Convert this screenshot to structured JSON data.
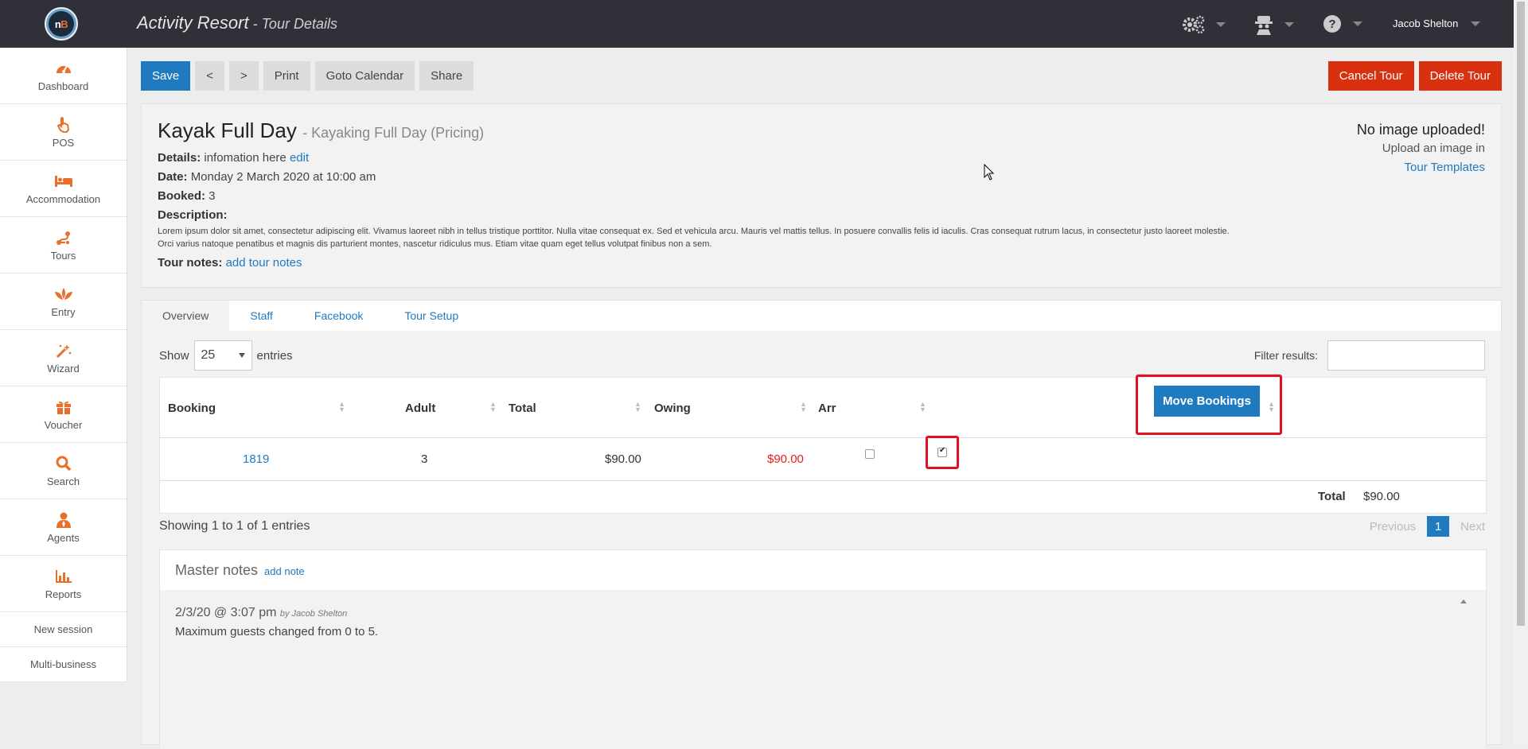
{
  "topbar": {
    "logo_n": "n",
    "logo_b": "B",
    "app_name": "Activity Resort",
    "separator": " - ",
    "page_name": "Tour Details",
    "user_name": "Jacob Shelton"
  },
  "sidebar": {
    "items": [
      {
        "label": "Dashboard",
        "icon": "dashboard-icon"
      },
      {
        "label": "POS",
        "icon": "hand-pointer-icon"
      },
      {
        "label": "Accommodation",
        "icon": "bed-icon"
      },
      {
        "label": "Tours",
        "icon": "route-icon"
      },
      {
        "label": "Entry",
        "icon": "lotus-icon"
      },
      {
        "label": "Wizard",
        "icon": "magic-wand-icon"
      },
      {
        "label": "Voucher",
        "icon": "gift-icon"
      },
      {
        "label": "Search",
        "icon": "search-icon"
      },
      {
        "label": "Agents",
        "icon": "user-icon"
      },
      {
        "label": "Reports",
        "icon": "bar-chart-icon"
      }
    ],
    "new_session": "New session",
    "multi_business": "Multi-business"
  },
  "toolbar": {
    "save": "Save",
    "prev": "<",
    "next": ">",
    "print": "Print",
    "goto_calendar": "Goto Calendar",
    "share": "Share",
    "cancel_tour": "Cancel Tour",
    "delete_tour": "Delete Tour"
  },
  "tour": {
    "name": "Kayak Full Day",
    "pricing": "- Kayaking Full Day (Pricing)",
    "details_label": "Details:",
    "details_value": "infomation here",
    "details_edit": "edit",
    "date_label": "Date:",
    "date_value": "Monday 2 March 2020 at 10:00 am",
    "booked_label": "Booked:",
    "booked_value": "3",
    "description_label": "Description:",
    "description_line1": "Lorem ipsum dolor sit amet, consectetur adipiscing elit. Vivamus laoreet nibh in tellus tristique porttitor. Nulla vitae consequat ex. Sed et vehicula arcu. Mauris vel mattis tellus. In posuere convallis felis id iaculis. Cras consequat rutrum lacus, in consectetur justo laoreet molestie.",
    "description_line2": "Orci varius natoque penatibus et magnis dis parturient montes, nascetur ridiculus mus. Etiam vitae quam eget tellus volutpat finibus non a sem.",
    "notes_label": "Tour notes:",
    "notes_link": "add tour notes"
  },
  "image_note": {
    "title": "No image uploaded!",
    "line": "Upload an image in",
    "link": "Tour Templates"
  },
  "tabs": [
    "Overview",
    "Staff",
    "Facebook",
    "Tour Setup"
  ],
  "table": {
    "show_label": "Show",
    "page_size": "25",
    "entries_label": "entries",
    "filter_label": "Filter results:",
    "headers": [
      "Booking",
      "Adult",
      "Total",
      "Owing",
      "Arr"
    ],
    "move_button": "Move Bookings",
    "rows": [
      {
        "booking": "1819",
        "adult": "3",
        "total": "$90.00",
        "owing": "$90.00",
        "arr_checked": false,
        "select_checked": true
      }
    ],
    "footer_label": "Total",
    "footer_value": "$90.00",
    "showing": "Showing 1 to 1 of 1 entries",
    "previous": "Previous",
    "page": "1",
    "next": "Next"
  },
  "notes": {
    "title": "Master notes",
    "add_note": "add note",
    "entries": [
      {
        "date": "2/3/20 @ 3:07 pm",
        "by": "by Jacob Shelton",
        "text": "Maximum guests changed from 0 to 5."
      }
    ]
  },
  "colors": {
    "topbar": "#2f3038",
    "accent_blue": "#1f7ac0",
    "danger_red": "#d9300f",
    "sidebar_icon_orange": "#e8702a",
    "highlight_red": "#e5101d"
  }
}
